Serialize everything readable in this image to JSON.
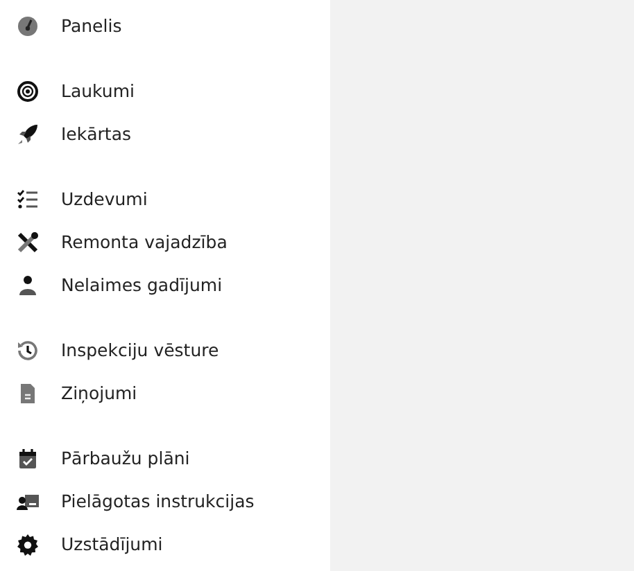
{
  "sidebar": {
    "groups": [
      {
        "items": [
          {
            "label": "Panelis"
          }
        ]
      },
      {
        "items": [
          {
            "label": "Laukumi"
          },
          {
            "label": "Iekārtas"
          }
        ]
      },
      {
        "items": [
          {
            "label": "Uzdevumi"
          },
          {
            "label": "Remonta vajadzība"
          },
          {
            "label": "Nelaimes gadījumi"
          }
        ]
      },
      {
        "items": [
          {
            "label": "Inspekciju vēsture"
          },
          {
            "label": "Ziņojumi"
          }
        ]
      },
      {
        "items": [
          {
            "label": "Pārbaužu plāni"
          },
          {
            "label": "Pielāgotas instrukcijas"
          },
          {
            "label": "Uzstādījumi"
          }
        ]
      }
    ]
  }
}
